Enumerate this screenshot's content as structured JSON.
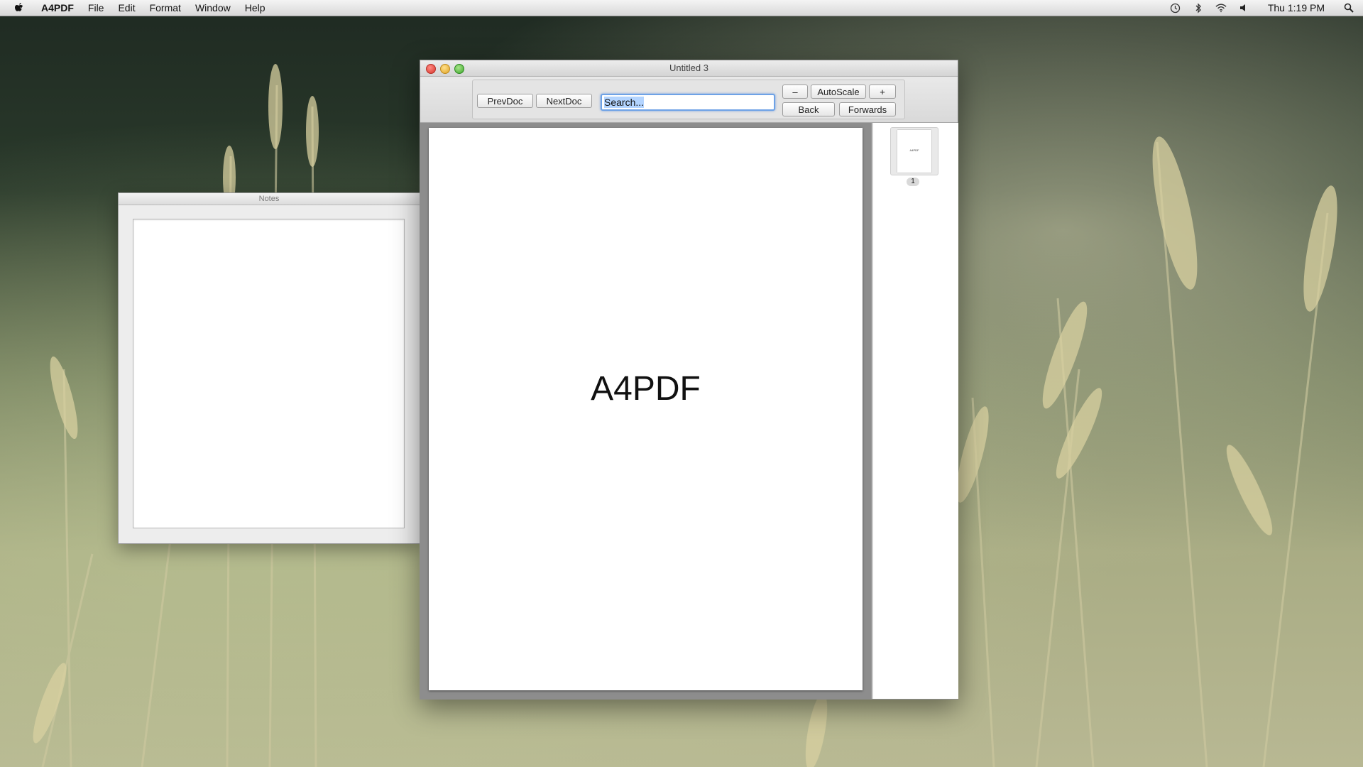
{
  "menubar": {
    "app_name": "A4PDF",
    "items": [
      "File",
      "Edit",
      "Format",
      "Window",
      "Help"
    ],
    "clock": "Thu 1:19 PM"
  },
  "notes": {
    "title": "Notes"
  },
  "window": {
    "title": "Untitled 3"
  },
  "toolbar": {
    "prev_doc": "PrevDoc",
    "next_doc": "NextDoc",
    "search_value": "Search...",
    "zoom_out": "–",
    "autoscale": "AutoScale",
    "zoom_in": "+",
    "back": "Back",
    "forwards": "Forwards"
  },
  "document": {
    "page_text": "A4PDF"
  },
  "thumbnails": {
    "items": [
      {
        "label": "1",
        "text": "A4PDF"
      }
    ]
  },
  "colors": {
    "accent": "#6ea2e6",
    "selection": "#b3d4ff"
  },
  "icons": {
    "status": [
      "time-machine-icon",
      "bluetooth-icon",
      "wifi-icon",
      "volume-icon",
      "spotlight-icon"
    ]
  }
}
